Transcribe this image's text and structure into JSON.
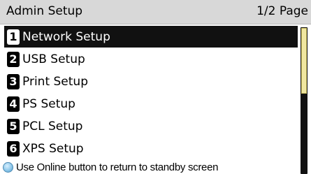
{
  "header": {
    "title": "Admin Setup",
    "page_indicator": "1/2 Page"
  },
  "menu": {
    "selected_index": 0,
    "items": [
      {
        "number": "1",
        "label": "Network Setup"
      },
      {
        "number": "2",
        "label": "USB Setup"
      },
      {
        "number": "3",
        "label": "Print Setup"
      },
      {
        "number": "4",
        "label": "PS Setup"
      },
      {
        "number": "5",
        "label": "PCL Setup"
      },
      {
        "number": "6",
        "label": "XPS Setup"
      }
    ]
  },
  "scrollbar": {
    "thumb_fraction": 0.45,
    "thumb_color": "#efe6a0"
  },
  "footer": {
    "icon": "online-button-icon",
    "text": "Use Online button to return to standby screen"
  },
  "colors": {
    "selected_background": "#111111",
    "header_background": "#d8d8d8"
  }
}
